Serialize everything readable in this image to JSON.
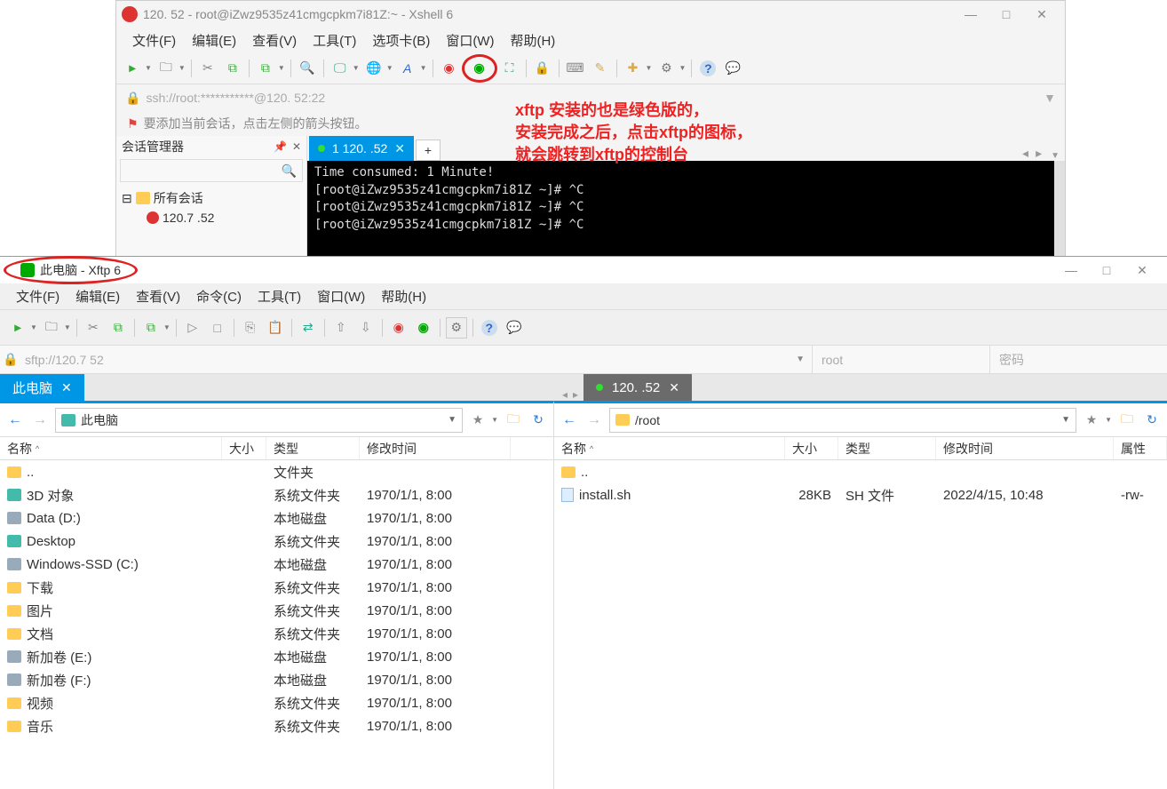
{
  "xshell": {
    "title": "120.        52 - root@iZwz9535z41cmgcpkm7i81Z:~ - Xshell 6",
    "menu": {
      "file": "文件(F)",
      "edit": "编辑(E)",
      "view": "查看(V)",
      "tools": "工具(T)",
      "tabs": "选项卡(B)",
      "window": "窗口(W)",
      "help": "帮助(H)"
    },
    "address": "ssh://root:***********@120.          52:22",
    "tip": "要添加当前会话，点击左侧的箭头按钮。",
    "session_panel_title": "会话管理器",
    "tree": {
      "all_sessions": "所有会话",
      "session1": "120.7       .52"
    },
    "tab_label": "1 120.           .52",
    "terminal_lines": "Time consumed: 1 Minute!\n[root@iZwz9535z41cmgcpkm7i81Z ~]# ^C\n[root@iZwz9535z41cmgcpkm7i81Z ~]# ^C\n[root@iZwz9535z41cmgcpkm7i81Z ~]# ^C"
  },
  "annotation": {
    "line1": "xftp 安装的也是绿色版的，",
    "line2": "安装完成之后，点击xftp的图标，",
    "line3": "就会跳转到xftp的控制台"
  },
  "xftp": {
    "title": "此电脑 - Xftp 6",
    "menu": {
      "file": "文件(F)",
      "edit": "编辑(E)",
      "view": "查看(V)",
      "cmd": "命令(C)",
      "tools": "工具(T)",
      "window": "窗口(W)",
      "help": "帮助(H)"
    },
    "address": "sftp://120.7       52",
    "user_placeholder": "root",
    "pass_placeholder": "密码",
    "local_tab": "此电脑",
    "remote_tab": "120.         .52",
    "local_path": "此电脑",
    "remote_path": "/root",
    "cols": {
      "name": "名称",
      "size": "大小",
      "type": "类型",
      "mtime": "修改时间",
      "attr": "属性"
    },
    "local_rows": [
      {
        "name": "..",
        "size": "",
        "type": "文件夹",
        "mtime": "",
        "icon": "folder"
      },
      {
        "name": "3D 对象",
        "size": "",
        "type": "系统文件夹",
        "mtime": "1970/1/1, 8:00",
        "icon": "pc"
      },
      {
        "name": "Data (D:)",
        "size": "",
        "type": "本地磁盘",
        "mtime": "1970/1/1, 8:00",
        "icon": "drive"
      },
      {
        "name": "Desktop",
        "size": "",
        "type": "系统文件夹",
        "mtime": "1970/1/1, 8:00",
        "icon": "pc"
      },
      {
        "name": "Windows-SSD (C:)",
        "size": "",
        "type": "本地磁盘",
        "mtime": "1970/1/1, 8:00",
        "icon": "drive"
      },
      {
        "name": "下载",
        "size": "",
        "type": "系统文件夹",
        "mtime": "1970/1/1, 8:00",
        "icon": "folder"
      },
      {
        "name": "图片",
        "size": "",
        "type": "系统文件夹",
        "mtime": "1970/1/1, 8:00",
        "icon": "folder"
      },
      {
        "name": "文档",
        "size": "",
        "type": "系统文件夹",
        "mtime": "1970/1/1, 8:00",
        "icon": "folder"
      },
      {
        "name": "新加卷 (E:)",
        "size": "",
        "type": "本地磁盘",
        "mtime": "1970/1/1, 8:00",
        "icon": "drive"
      },
      {
        "name": "新加卷 (F:)",
        "size": "",
        "type": "本地磁盘",
        "mtime": "1970/1/1, 8:00",
        "icon": "drive"
      },
      {
        "name": "视频",
        "size": "",
        "type": "系统文件夹",
        "mtime": "1970/1/1, 8:00",
        "icon": "folder"
      },
      {
        "name": "音乐",
        "size": "",
        "type": "系统文件夹",
        "mtime": "1970/1/1, 8:00",
        "icon": "folder"
      }
    ],
    "remote_rows": [
      {
        "name": "..",
        "size": "",
        "type": "",
        "mtime": "",
        "attr": "",
        "icon": "folder"
      },
      {
        "name": "install.sh",
        "size": "28KB",
        "type": "SH 文件",
        "mtime": "2022/4/15, 10:48",
        "attr": "-rw-",
        "icon": "file"
      }
    ]
  }
}
